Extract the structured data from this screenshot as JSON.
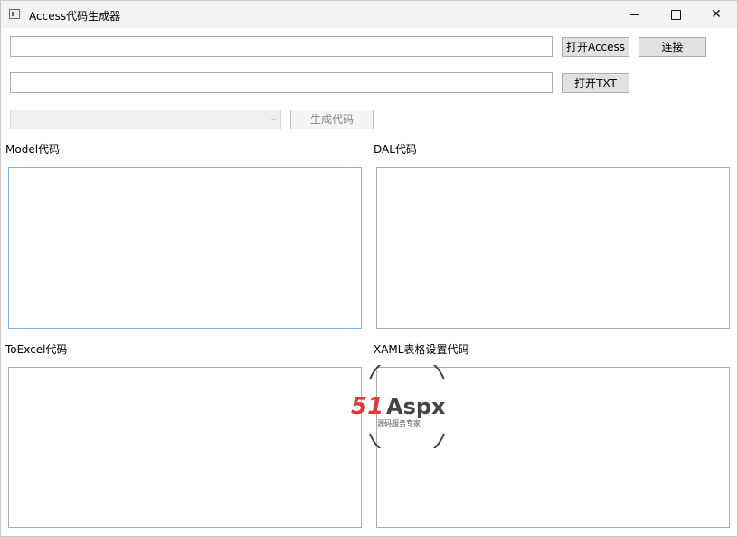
{
  "window": {
    "title": "Access代码生成器",
    "icon": "app-window-icon"
  },
  "controls": {
    "minimize_icon": "minimize-icon",
    "maximize_icon": "maximize-icon",
    "close_label": "✕"
  },
  "row1": {
    "path_value": "",
    "open_access_label": "打开Access",
    "connect_label": "连接"
  },
  "row2": {
    "path_value": "",
    "open_txt_label": "打开TXT"
  },
  "row3": {
    "table_select_value": "",
    "generate_label": "生成代码"
  },
  "sections": {
    "model_label": "Model代码",
    "dal_label": "DAL代码",
    "toexcel_label": "ToExcel代码",
    "xaml_label": "XAML表格设置代码"
  },
  "watermark": {
    "brand_prefix": "51",
    "brand_suffix": "Aspx",
    "tagline": "源码服务专家"
  },
  "colors": {
    "focus_border": "#7eb4ea",
    "watermark_red": "#e03a3a",
    "watermark_green": "#4caf50"
  }
}
